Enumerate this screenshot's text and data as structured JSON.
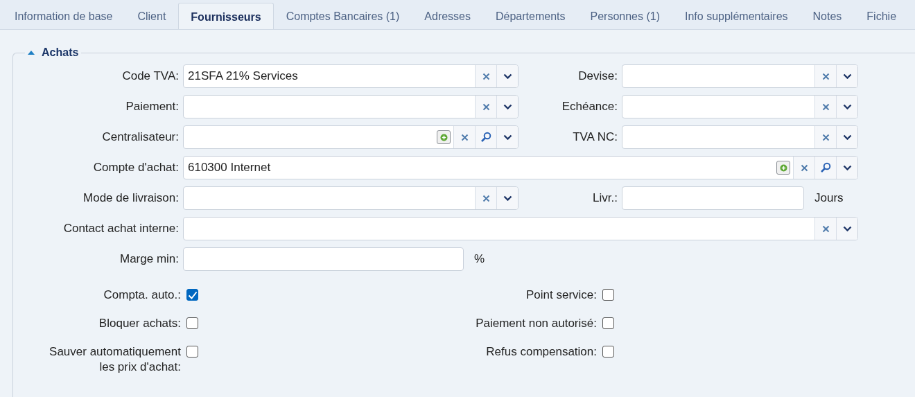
{
  "tabs": [
    {
      "label": "Information de base",
      "selected": false
    },
    {
      "label": "Client",
      "selected": false
    },
    {
      "label": "Fournisseurs",
      "selected": true
    },
    {
      "label": "Comptes Bancaires (1)",
      "selected": false
    },
    {
      "label": "Adresses",
      "selected": false
    },
    {
      "label": "Départements",
      "selected": false
    },
    {
      "label": "Personnes (1)",
      "selected": false
    },
    {
      "label": "Info supplémentaires",
      "selected": false
    },
    {
      "label": "Notes",
      "selected": false
    },
    {
      "label": "Fichie",
      "selected": false
    }
  ],
  "section": {
    "title": "Achats",
    "expanded": true
  },
  "rows": [
    {
      "kind": "pair",
      "left": {
        "label": "Code TVA:",
        "value": "21SFA 21% Services",
        "buttons": [
          {
            "kind": "clear"
          },
          {
            "kind": "dropdown"
          }
        ]
      },
      "right": {
        "label": "Devise:",
        "buttons": [
          {
            "kind": "clear"
          },
          {
            "kind": "dropdown"
          }
        ]
      }
    },
    {
      "kind": "pair",
      "left": {
        "label": "Paiement:",
        "buttons": [
          {
            "kind": "clear"
          },
          {
            "kind": "dropdown"
          }
        ]
      },
      "right": {
        "label": "Echéance:",
        "buttons": [
          {
            "kind": "clear"
          },
          {
            "kind": "dropdown"
          }
        ]
      }
    },
    {
      "kind": "pair",
      "left": {
        "label": "Centralisateur:",
        "buttons": [
          {
            "kind": "add"
          },
          {
            "kind": "clear"
          },
          {
            "kind": "search"
          },
          {
            "kind": "dropdown"
          }
        ]
      },
      "right": {
        "label": "TVA NC:",
        "buttons": [
          {
            "kind": "clear"
          },
          {
            "kind": "dropdown"
          }
        ]
      }
    },
    {
      "kind": "wide",
      "left": {
        "label": "Compte d'achat:",
        "value": "610300 Internet",
        "buttons": [
          {
            "kind": "add"
          },
          {
            "kind": "clear"
          },
          {
            "kind": "search"
          },
          {
            "kind": "dropdown"
          }
        ]
      }
    },
    {
      "kind": "pair",
      "left": {
        "label": "Mode de livraison:",
        "buttons": [
          {
            "kind": "clear"
          },
          {
            "kind": "dropdown"
          }
        ]
      },
      "right": {
        "label": "Livr.:",
        "suffix": "Jours"
      }
    },
    {
      "kind": "wide",
      "left": {
        "label": "Contact achat interne:",
        "buttons": [
          {
            "kind": "clear"
          },
          {
            "kind": "dropdown"
          }
        ]
      }
    },
    {
      "kind": "pair",
      "left": {
        "label": "Marge min:",
        "suffix": "%"
      }
    },
    {
      "kind": "checks",
      "left": {
        "label": "Compta. auto.:",
        "checked": true
      },
      "right": {
        "label": "Point service:",
        "checked": false
      }
    },
    {
      "kind": "checks",
      "left": {
        "label": "Bloquer achats:",
        "checked": false
      },
      "right": {
        "label": "Paiement non autorisé:",
        "checked": false
      }
    },
    {
      "kind": "checks",
      "left": {
        "label": "Sauver automatiquement les prix d'achat:",
        "checked": false
      },
      "right": {
        "label": "Refus compensation:",
        "checked": false
      }
    }
  ]
}
